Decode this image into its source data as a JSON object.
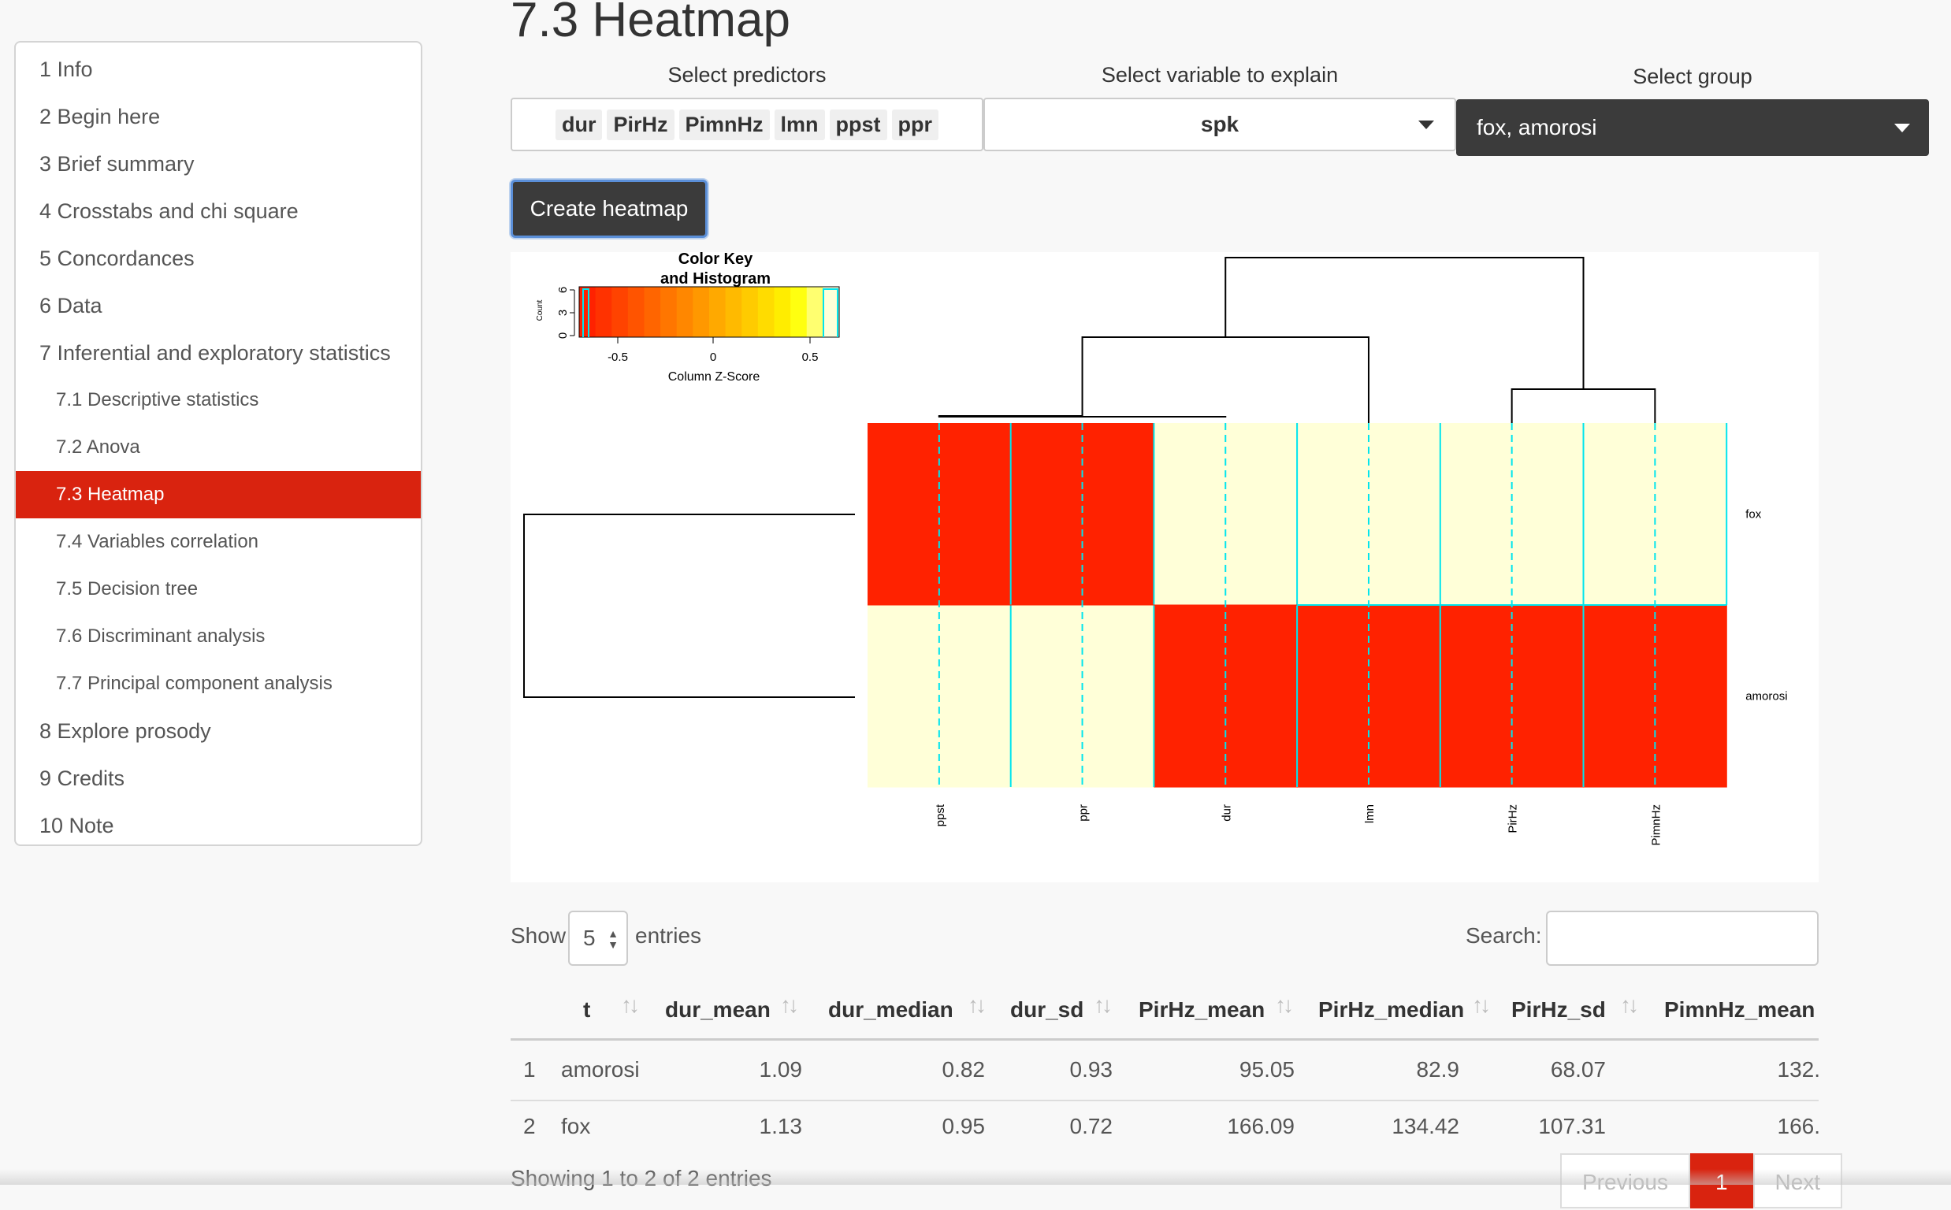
{
  "toc": [
    {
      "label": "1 Info",
      "level": 1,
      "active": false
    },
    {
      "label": "2 Begin here",
      "level": 1,
      "active": false
    },
    {
      "label": "3 Brief summary",
      "level": 1,
      "active": false
    },
    {
      "label": "4 Crosstabs and chi square",
      "level": 1,
      "active": false
    },
    {
      "label": "5 Concordances",
      "level": 1,
      "active": false
    },
    {
      "label": "6 Data",
      "level": 1,
      "active": false
    },
    {
      "label": "7 Inferential and exploratory statistics",
      "level": 1,
      "active": false
    },
    {
      "label": "7.1 Descriptive statistics",
      "level": 2,
      "active": false
    },
    {
      "label": "7.2 Anova",
      "level": 2,
      "active": false
    },
    {
      "label": "7.3 Heatmap",
      "level": 2,
      "active": true
    },
    {
      "label": "7.4 Variables correlation",
      "level": 2,
      "active": false
    },
    {
      "label": "7.5 Decision tree",
      "level": 2,
      "active": false
    },
    {
      "label": "7.6 Discriminant analysis",
      "level": 2,
      "active": false
    },
    {
      "label": "7.7 Principal component analysis",
      "level": 2,
      "active": false
    },
    {
      "label": "8 Explore prosody",
      "level": 1,
      "active": false
    },
    {
      "label": "9 Credits",
      "level": 1,
      "active": false
    },
    {
      "label": "10 Note",
      "level": 1,
      "active": false
    }
  ],
  "page": {
    "title": "7.3 Heatmap"
  },
  "controls": {
    "predictors_label": "Select predictors",
    "predictors": [
      "dur",
      "PirHz",
      "PimnHz",
      "lmn",
      "ppst",
      "ppr"
    ],
    "variable_label": "Select variable to explain",
    "variable_value": "spk",
    "group_label": "Select group",
    "group_value": "fox, amorosi",
    "create_button": "Create heatmap"
  },
  "heatmap": {
    "color_key_title": "Color Key",
    "color_key_subtitle": "and Histogram",
    "count_label": "Count",
    "count_ticks": [
      "0",
      "3",
      "6"
    ],
    "zscore_ticks": [
      "-0.5",
      "0",
      "0.5"
    ],
    "zscore_label": "Column Z-Score",
    "columns": [
      "ppst",
      "ppr",
      "dur",
      "lmn",
      "PirHz",
      "PimnHz"
    ],
    "rows": [
      "fox",
      "amorosi"
    ],
    "cells": [
      [
        "high",
        "high",
        "low",
        "low",
        "low",
        "low"
      ],
      [
        "low",
        "low",
        "high",
        "high",
        "high",
        "high"
      ]
    ],
    "colors": {
      "high": "#ff2200",
      "low": "#ffffd8",
      "trace": "#00e5ee"
    }
  },
  "table": {
    "show_label": "Show",
    "length_value": "5",
    "entries_label": "entries",
    "search_label": "Search:",
    "columns": [
      "t",
      "dur_mean",
      "dur_median",
      "dur_sd",
      "PirHz_mean",
      "PirHz_median",
      "PirHz_sd",
      "PimnHz_mean"
    ],
    "rows": [
      {
        "idx": "1",
        "t": "amorosi",
        "dur_mean": "1.09",
        "dur_median": "0.82",
        "dur_sd": "0.93",
        "PirHz_mean": "95.05",
        "PirHz_median": "82.9",
        "PirHz_sd": "68.07",
        "PimnHz_mean": "132."
      },
      {
        "idx": "2",
        "t": "fox",
        "dur_mean": "1.13",
        "dur_median": "0.95",
        "dur_sd": "0.72",
        "PirHz_mean": "166.09",
        "PirHz_median": "134.42",
        "PirHz_sd": "107.31",
        "PimnHz_mean": "166."
      }
    ],
    "info": "Showing 1 to 2 of 2 entries",
    "prev_label": "Previous",
    "current_page": "1",
    "next_label": "Next"
  },
  "icons": {
    "sort": "sort-icon",
    "dropdown": "chevron-down-icon"
  }
}
